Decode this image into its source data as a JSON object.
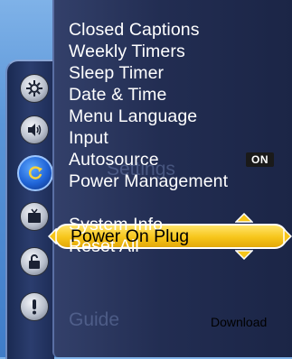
{
  "menu": {
    "items": [
      {
        "label": "Closed Captions"
      },
      {
        "label": "Weekly Timers"
      },
      {
        "label": "Sleep Timer"
      },
      {
        "label": "Date & Time"
      },
      {
        "label": "Menu Language"
      },
      {
        "label": "Input"
      },
      {
        "label": "Autosource",
        "badge": "ON"
      },
      {
        "label": "Power Management"
      },
      {
        "label": "Power On Plug",
        "selected": true
      },
      {
        "label": "System Info"
      },
      {
        "label": "Reset All"
      }
    ],
    "selected_label": "Power On Plug"
  },
  "rail": {
    "icons": [
      "gear-icon",
      "speaker-icon",
      "refresh-icon",
      "tv-icon",
      "lock-icon",
      "alert-icon"
    ],
    "active_icon": "refresh-icon"
  },
  "ghost": {
    "settings": "Settings",
    "guide": "Guide"
  },
  "watermark": "Download",
  "colors": {
    "highlight": "#f7c51a",
    "panel": "#222d52",
    "text": "#ffffff"
  }
}
